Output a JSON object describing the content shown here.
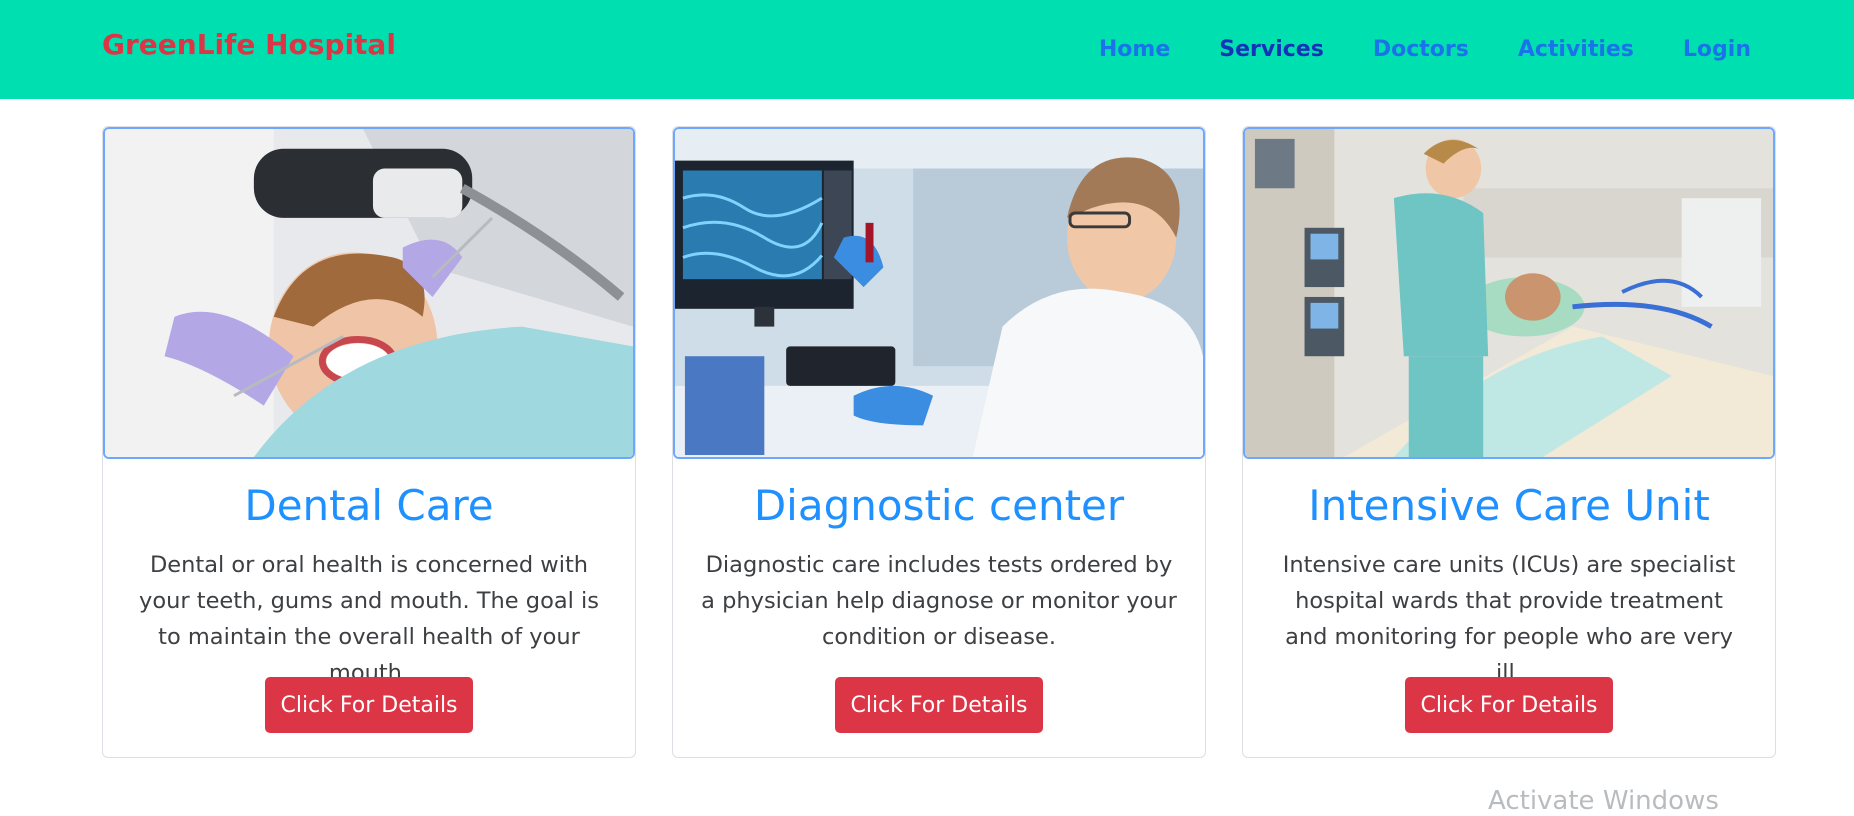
{
  "header": {
    "brand": "GreenLife Hospital",
    "nav": [
      {
        "label": "Home"
      },
      {
        "label": "Services"
      },
      {
        "label": "Doctors"
      },
      {
        "label": "Activities"
      },
      {
        "label": "Login"
      }
    ]
  },
  "cards": [
    {
      "title": "Dental Care",
      "text": "Dental or oral health is concerned with your teeth, gums and mouth. The goal is to maintain the overall health of your mouth.",
      "button": "Click For Details",
      "image": "dental-care-photo"
    },
    {
      "title": "Diagnostic center",
      "text": "Diagnostic care includes tests ordered by a physician help diagnose or monitor your condition or disease.",
      "button": "Click For Details",
      "image": "diagnostic-lab-photo"
    },
    {
      "title": "Intensive Care Unit",
      "text": "Intensive care units (ICUs) are specialist hospital wards that provide treatment and monitoring for people who are very ill.",
      "button": "Click For Details",
      "image": "icu-photo"
    }
  ],
  "watermark": "Activate Windows",
  "colors": {
    "navbar": "#00dfb0",
    "brand": "#dc3545",
    "nav_link": "#1a73e8",
    "card_title": "#1e90ff",
    "button": "#dc3545",
    "image_border": "#6ea8fe"
  }
}
